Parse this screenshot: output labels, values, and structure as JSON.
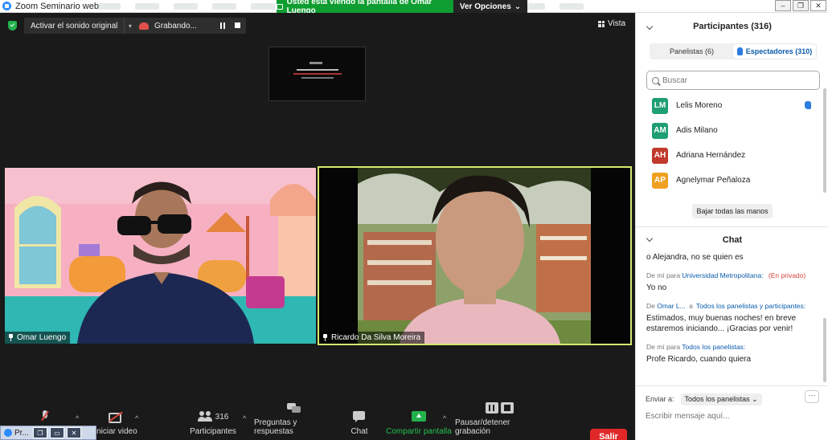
{
  "window": {
    "title": "Zoom Seminario web",
    "share_banner": "Usted está viendo la pantalla de Omar Luengo",
    "view_options": "Ver Opciones",
    "view_options_caret": "⌄"
  },
  "top_controls": {
    "audio_label": "Activar el sonido original",
    "audio_caret": "▾",
    "recording_label": "Grabando...",
    "view_label": "Vista"
  },
  "videos": {
    "left": {
      "name": "Omar Luengo"
    },
    "right": {
      "name": "Ricardo Da Silva Moreira"
    }
  },
  "toolbar": {
    "video_label": "Iniciar video",
    "participants_label": "Participantes",
    "participants_count": "316",
    "qa_label": "Preguntas y respuestas",
    "chat_label": "Chat",
    "share_label": "Compartir pantalla",
    "record_label": "Pausar/detener grabación",
    "leave_label": "Salir",
    "caret": "^"
  },
  "taskbar": {
    "label": "Pr..."
  },
  "participants": {
    "header": "Participantes (316)",
    "tab_panelists": "Panelistas (6)",
    "tab_attendees": "Espectadores (310)",
    "search_placeholder": "Buscar",
    "list": [
      {
        "initials": "LM",
        "name": "Lelis Moreno",
        "color": "#1f9e73"
      },
      {
        "initials": "AM",
        "name": "Adis Milano",
        "color": "#1f9e73"
      },
      {
        "initials": "AH",
        "name": "Adriana Hernández",
        "color": "#c0392b"
      },
      {
        "initials": "AP",
        "name": "Agnelymar Peñaloza",
        "color": "#f0a020"
      }
    ],
    "lower_all_hands": "Bajar todas las manos"
  },
  "chat": {
    "header": "Chat",
    "messages": [
      {
        "text": "o Alejandra, no se quien es"
      },
      {
        "from": "De mí para",
        "to": "Universidad Metropolitana:",
        "private": "(En privado)",
        "text": "Yo no"
      },
      {
        "from": "De",
        "sender": "Omar L...",
        "mid": "a",
        "to": "Todos los panelistas y participantes:",
        "text": "Estimados, muy buenas noches! en breve estaremos iniciando... ¡Gracias por venir!"
      },
      {
        "from": "De mí para",
        "to": "Todos los panelistas:",
        "text": "Profe Ricardo, cuando quiera"
      }
    ],
    "send_to_label": "Enviar a:",
    "send_to_value": "Todos los panelistas",
    "send_to_caret": "⌄",
    "more_label": "···",
    "input_placeholder": "Escribir mensaje aquí..."
  }
}
